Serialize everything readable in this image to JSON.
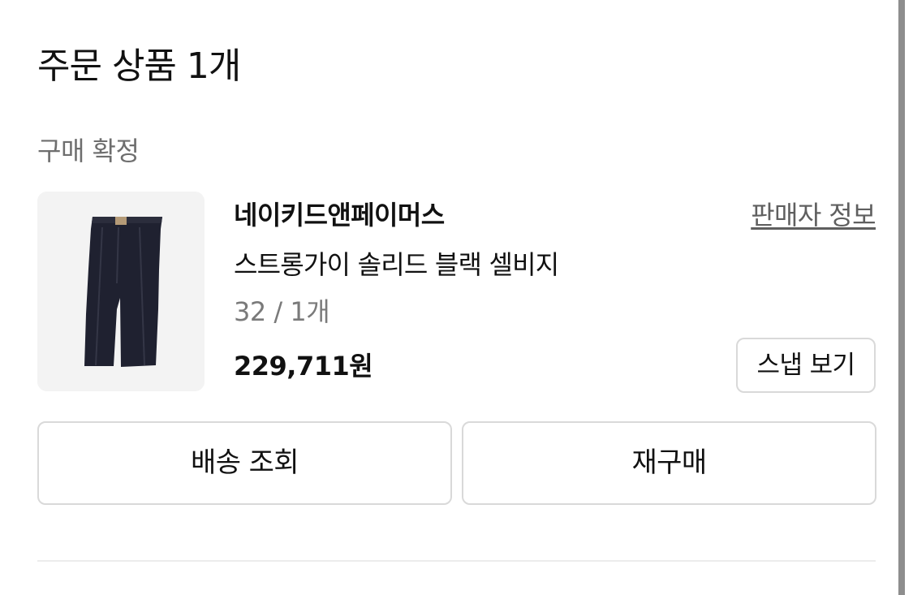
{
  "order": {
    "title": "주문 상품 1개",
    "status": "구매 확정"
  },
  "product": {
    "brand": "네이키드앤페이머스",
    "seller_link": "판매자 정보",
    "name": "스트롱가이 솔리드 블랙 셀비지",
    "option": "32 / 1개",
    "price": "229,711원",
    "snap_button": "스냅 보기"
  },
  "actions": {
    "track_shipping": "배송 조회",
    "reorder": "재구매"
  },
  "colors": {
    "text_primary": "#111111",
    "text_secondary": "#6e6e6e",
    "border": "#d9d9d9",
    "thumb_bg": "#f3f3f3",
    "product_dark": "#1f2130"
  }
}
